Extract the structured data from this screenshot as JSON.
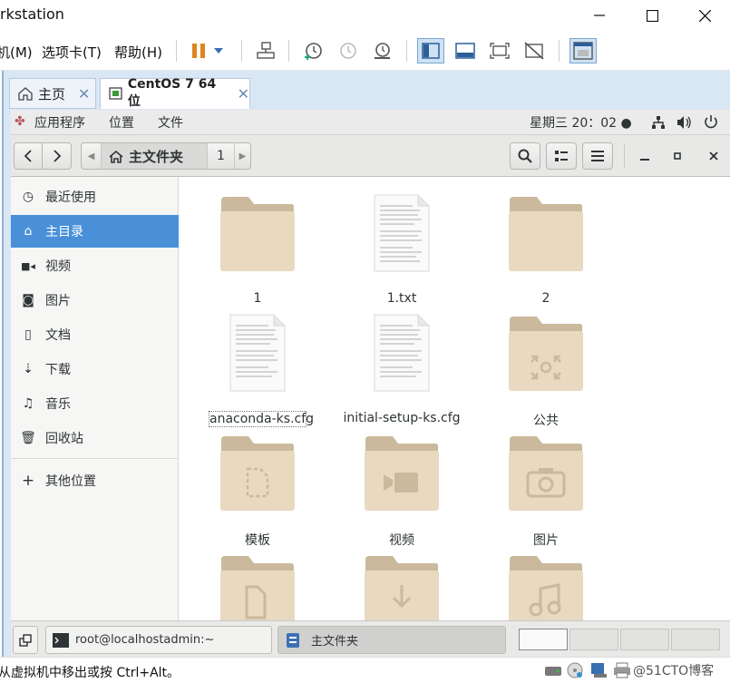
{
  "window": {
    "title": "rkstation"
  },
  "menubar": {
    "items": [
      "机(M)",
      "选项卡(T)",
      "帮助(H)"
    ]
  },
  "tabs": [
    {
      "label": "主页"
    },
    {
      "label": "CentOS 7 64 位"
    }
  ],
  "guest_topbar": {
    "apps": "应用程序",
    "places": "位置",
    "file": "文件",
    "clock": "星期三 20：02 ●"
  },
  "pathbar": {
    "home_label": "主文件夹",
    "child": "1"
  },
  "sidebar": {
    "items": [
      {
        "label": "最近使用",
        "icon": "clock-icon"
      },
      {
        "label": "主目录",
        "icon": "home-icon"
      },
      {
        "label": "视频",
        "icon": "video-icon"
      },
      {
        "label": "图片",
        "icon": "camera-icon"
      },
      {
        "label": "文档",
        "icon": "document-icon"
      },
      {
        "label": "下载",
        "icon": "download-icon"
      },
      {
        "label": "音乐",
        "icon": "music-icon"
      },
      {
        "label": "回收站",
        "icon": "trash-icon"
      },
      {
        "label": "其他位置",
        "icon": "plus-icon"
      }
    ]
  },
  "files": [
    {
      "name": "1",
      "kind": "folder"
    },
    {
      "name": "1.txt",
      "kind": "text"
    },
    {
      "name": "2",
      "kind": "folder"
    },
    {
      "name": "anaconda-ks.cfg",
      "kind": "text"
    },
    {
      "name": "initial-setup-ks.cfg",
      "kind": "text"
    },
    {
      "name": "公共",
      "kind": "folder-share"
    },
    {
      "name": "模板",
      "kind": "folder-template"
    },
    {
      "name": "视频",
      "kind": "folder-video"
    },
    {
      "name": "图片",
      "kind": "folder-picture"
    },
    {
      "name": "",
      "kind": "folder-documents"
    },
    {
      "name": "",
      "kind": "folder-download"
    },
    {
      "name": "",
      "kind": "folder-music"
    }
  ],
  "taskbar": {
    "terminal": "root@localhostadmin:~",
    "files": "主文件夹"
  },
  "statusbar": {
    "hint": "从虚拟机中移出或按 Ctrl+Alt。",
    "watermark": "@51CTO博客"
  },
  "colors": {
    "accent": "#4a90d9",
    "folder": "#e9d9c0",
    "folder_tab": "#cbb99d"
  }
}
